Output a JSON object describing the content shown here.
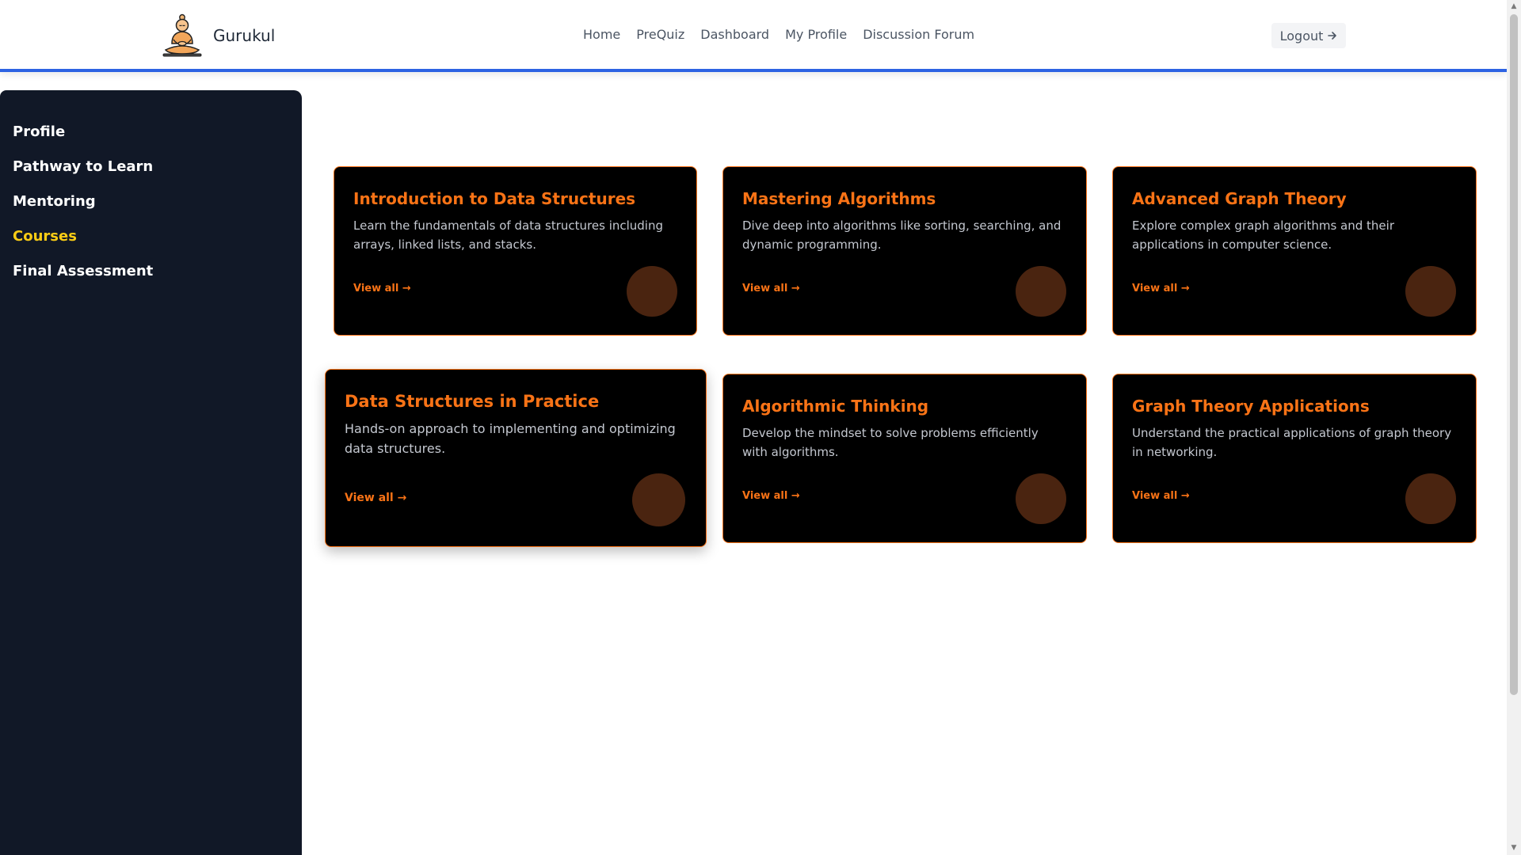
{
  "header": {
    "brand_name": "Gurukul",
    "nav": [
      "Home",
      "PreQuiz",
      "Dashboard",
      "My Profile",
      "Discussion Forum"
    ],
    "logout_label": "Logout",
    "logout_icon": "arrow-right-icon"
  },
  "sidebar": {
    "items": [
      {
        "label": "Profile",
        "active": false
      },
      {
        "label": "Pathway to Learn",
        "active": false
      },
      {
        "label": "Mentoring",
        "active": false
      },
      {
        "label": "Courses",
        "active": true
      },
      {
        "label": "Final Assessment",
        "active": false
      }
    ]
  },
  "courses": [
    {
      "title": "Introduction to Data Structures",
      "description": "Learn the fundamentals of data structures including arrays, linked lists, and stacks.",
      "link": "View all →"
    },
    {
      "title": "Mastering Algorithms",
      "description": "Dive deep into algorithms like sorting, searching, and dynamic programming.",
      "link": "View all →"
    },
    {
      "title": "Advanced Graph Theory",
      "description": "Explore complex graph algorithms and their applications in computer science.",
      "link": "View all →"
    },
    {
      "title": "Data Structures in Practice",
      "description": "Hands-on approach to implementing and optimizing data structures.",
      "link": "View all →"
    },
    {
      "title": "Algorithmic Thinking",
      "description": "Develop the mindset to solve problems efficiently with algorithms.",
      "link": "View all →"
    },
    {
      "title": "Graph Theory Applications",
      "description": "Understand the practical applications of graph theory in networking.",
      "link": "View all →"
    }
  ],
  "colors": {
    "accent": "#f97316",
    "header_underline": "#2d63e3",
    "sidebar_bg": "#111827",
    "sidebar_active": "#facc15",
    "card_bg": "#000000",
    "card_circle": "#4a2410"
  }
}
